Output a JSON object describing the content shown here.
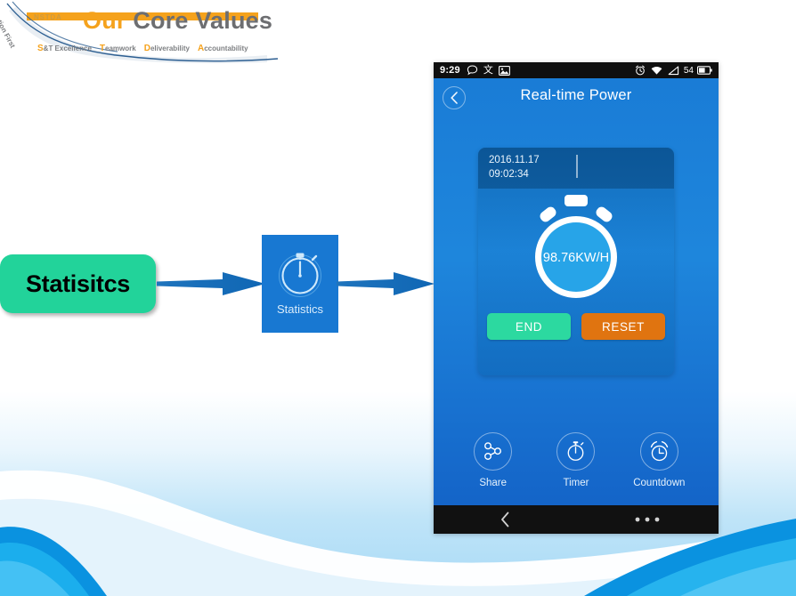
{
  "slide": {
    "header": {
      "logo_label": "NSTDA",
      "tagline_rotated": "Nation First",
      "title_accent": "Our",
      "title_rest": "Core Values",
      "values": [
        {
          "initial": "S",
          "rest": "&T Excellence"
        },
        {
          "initial": "T",
          "rest": "eamwork"
        },
        {
          "initial": "D",
          "rest": "eliverability"
        },
        {
          "initial": "A",
          "rest": "ccountability"
        }
      ]
    },
    "watermark_lines": [
      "",
      "",
      ""
    ]
  },
  "flow": {
    "box_label": "Statisitcs",
    "box_color": "#22D39A",
    "arrow_color": "#1569B4",
    "app_icon": {
      "label": "Statistics",
      "tile_color": "#1878D2",
      "icon_name": "stopwatch-icon"
    }
  },
  "phone": {
    "statusbar": {
      "time": "9:29",
      "battery_percent": "54",
      "left_icons": [
        "message-icon",
        "input-method-icon",
        "image-icon"
      ],
      "right_icons": [
        "alarm-icon",
        "wifi-icon",
        "signal-icon",
        "battery-icon"
      ]
    },
    "appbar": {
      "title": "Real-time Power",
      "back_icon": "chevron-left-icon"
    },
    "card": {
      "date": "2016.11.17",
      "time": "09:02:34",
      "gauge_value": "98.76KW/H",
      "gauge_icon": "stopwatch-icon",
      "buttons": [
        {
          "label": "END",
          "color": "#2CD9A0"
        },
        {
          "label": "RESET",
          "color": "#E07410"
        }
      ]
    },
    "actions": [
      {
        "label": "Share",
        "icon": "share-icon"
      },
      {
        "label": "Timer",
        "icon": "stopwatch-icon"
      },
      {
        "label": "Countdown",
        "icon": "alarm-clock-icon"
      }
    ],
    "navbar": {
      "back_icon": "chevron-left-icon",
      "menu_icon": "overflow-menu-icon"
    },
    "theme": {
      "screen_top": "#1A7CD6",
      "screen_bottom": "#1464C8",
      "statusbar_bg": "#0F0F0F",
      "navbar_bg": "#111111"
    }
  }
}
